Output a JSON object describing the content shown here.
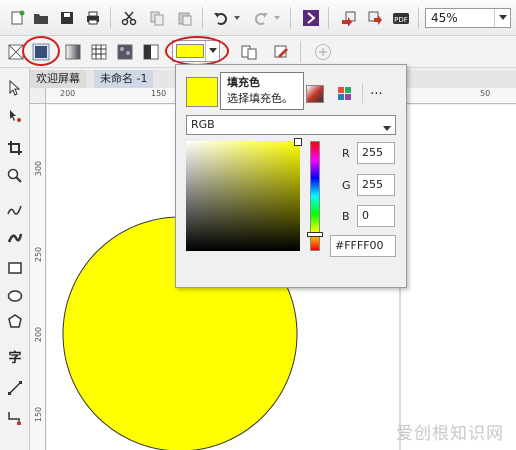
{
  "toolbar": {
    "zoom_value": "45%",
    "icons": [
      "new-icon",
      "open-icon",
      "save-icon",
      "print-icon",
      "cut-icon",
      "copy-icon",
      "paste-icon",
      "undo-icon",
      "redo-icon",
      "corel-app-icon",
      "import-icon",
      "export-icon",
      "pdf-icon"
    ]
  },
  "property_bar": {
    "fill_color": "#FFFF00"
  },
  "tabs": {
    "welcome": "欢迎屏幕",
    "document": "未命名 -1"
  },
  "ruler": {
    "h_labels": [
      "200",
      "150",
      "50"
    ],
    "v_labels": [
      "300",
      "250",
      "200",
      "150"
    ]
  },
  "fill_popup": {
    "color_model": "RGB",
    "r_label": "R",
    "r_value": "255",
    "g_label": "G",
    "g_value": "255",
    "b_label": "B",
    "b_value": "0",
    "hex_value": "#FFFF00",
    "more_button": "...",
    "swatch_color": "#FFFF00"
  },
  "tooltip": {
    "title": "填充色",
    "description": "选择填充色。"
  },
  "canvas": {
    "circle_fill": "#FFFF00"
  },
  "watermark": "爱创根知识网"
}
